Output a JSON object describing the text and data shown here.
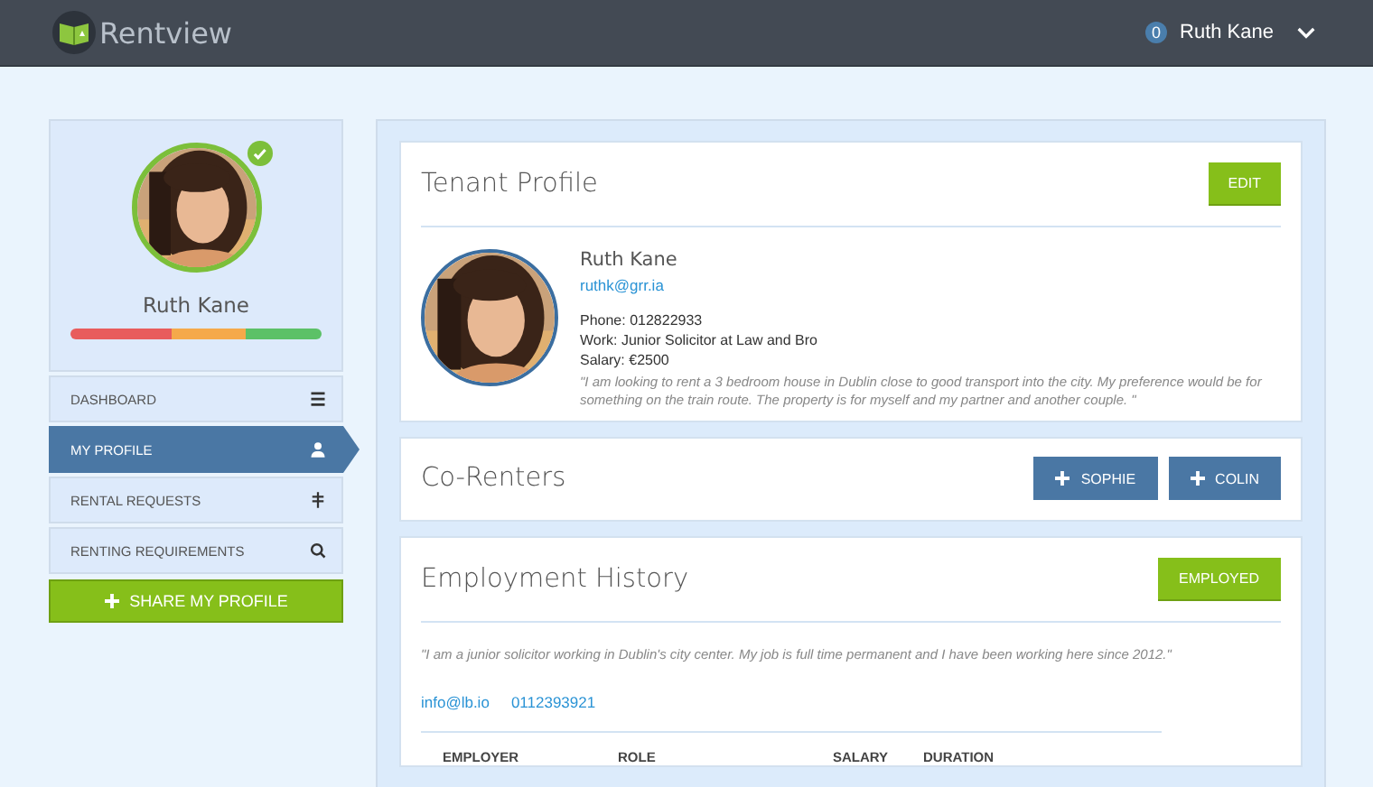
{
  "header": {
    "brand": "Rentview",
    "notifications": "0",
    "user": "Ruth Kane"
  },
  "sidebar": {
    "profile": {
      "name": "Ruth Kane",
      "verified": true,
      "segments": [
        {
          "color": "#e85c5c"
        },
        {
          "color": "#f5a94a"
        },
        {
          "color": "#5cc167"
        }
      ]
    },
    "items": [
      {
        "label": "DASHBOARD",
        "kind": "list",
        "selected": false
      },
      {
        "label": "MY PROFILE",
        "kind": "person",
        "selected": true
      },
      {
        "label": "RENTAL REQUESTS",
        "kind": "signpost",
        "selected": false
      },
      {
        "label": "RENTING REQUIREMENTS",
        "kind": "search",
        "selected": false
      }
    ],
    "share_button": "SHARE MY PROFILE"
  },
  "tenant_profile": {
    "title": "Tenant Profile",
    "edit_button": "EDIT",
    "name": "Ruth Kane",
    "email": "ruthk@grr.ia",
    "details": [
      "Phone: 012822933",
      "Work: Junior Solicitor at Law and Bro",
      "Salary: €2500"
    ],
    "quote": "\"I am looking to rent a 3 bedroom house in Dublin close to good transport into the city. My preference would be for something on the train route. The property is for myself and my partner and another couple. \""
  },
  "co_renters": {
    "title": "Co-Renters",
    "buttons": [
      "SOPHIE",
      "COLIN"
    ]
  },
  "employment_history": {
    "title": "Employment History",
    "status_button": "EMPLOYED",
    "quote": "\"I am a junior solicitor working in Dublin's city center. My job is full time permanent and I have been working here since 2012.\"",
    "email": "info@lb.io",
    "phone": "0112393921",
    "columns": [
      "EMPLOYER",
      "ROLE",
      "SALARY",
      "DURATION"
    ]
  }
}
